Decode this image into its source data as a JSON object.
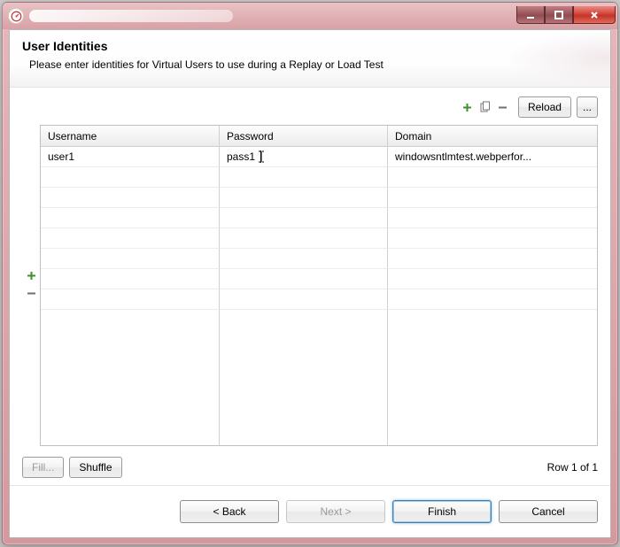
{
  "header": {
    "title": "User Identities",
    "description": "Please enter identities for Virtual Users to use during a Replay or Load Test"
  },
  "toolbar": {
    "add_icon": "plus",
    "copy_icon": "copy",
    "remove_icon": "minus",
    "reload_label": "Reload",
    "browse_label": "..."
  },
  "side": {
    "add_icon": "plus",
    "remove_icon": "minus"
  },
  "columns": {
    "username": "Username",
    "password": "Password",
    "domain": "Domain"
  },
  "rows": [
    {
      "username": "user1",
      "password": "pass1",
      "domain": "windowsntlmtest.webperfor..."
    }
  ],
  "footer": {
    "fill_label": "Fill...",
    "shuffle_label": "Shuffle",
    "status": "Row 1 of 1"
  },
  "buttons": {
    "back": "< Back",
    "next": "Next >",
    "finish": "Finish",
    "cancel": "Cancel"
  }
}
